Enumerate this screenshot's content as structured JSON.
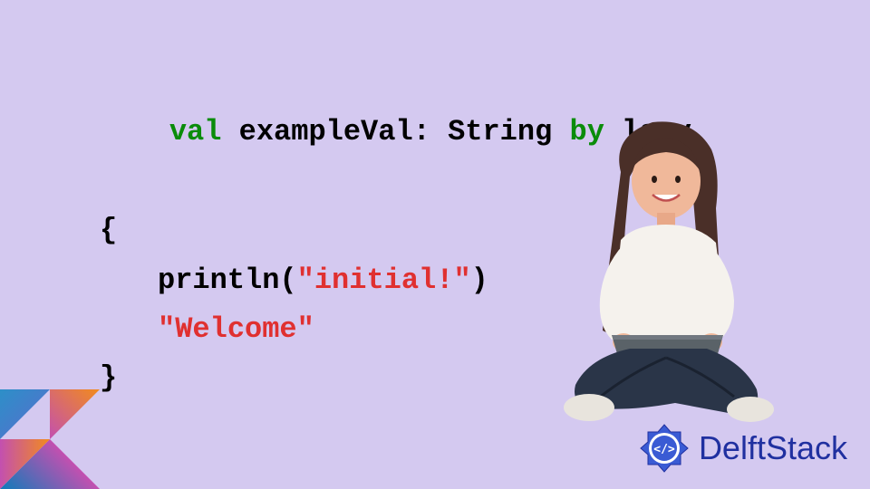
{
  "code": {
    "line1": {
      "val": "val",
      "name": " exampleVal: String ",
      "by": "by",
      "lazy": " lazy"
    },
    "line2": "{",
    "line3": {
      "fn": "println(",
      "str": "\"initial!\"",
      "close": ")"
    },
    "line4": "\"Welcome\"",
    "line5": "}"
  },
  "brand": {
    "name": "DelftStack"
  },
  "alt": {
    "kotlin_logo": "Kotlin logo",
    "person": "Person sitting with laptop",
    "delftstack_badge": "DelftStack badge"
  }
}
